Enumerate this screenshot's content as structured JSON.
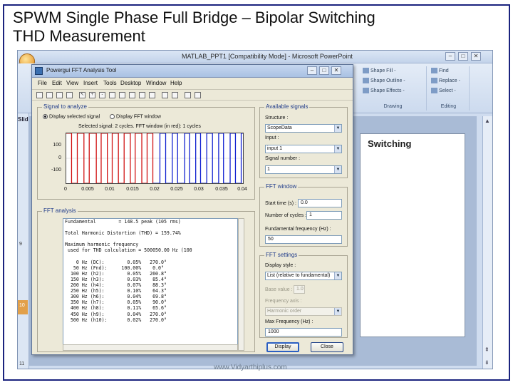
{
  "slide": {
    "title_line1": "SPWM Single Phase Full Bridge – Bipolar Switching",
    "title_line2": "THD Measurement",
    "watermark": "www.Vidyarthiplus.com"
  },
  "powerpoint": {
    "window_title": "MATLAB_PPT1 [Compatibility Mode] - Microsoft PowerPoint",
    "ribbon": {
      "shape_fill": "Shape Fill -",
      "shape_outline": "Shape Outline -",
      "shape_effects": "Shape Effects -",
      "find": "Find",
      "replace": "Replace -",
      "select": "Select -",
      "drawing_group": "Drawing",
      "editing_group": "Editing"
    },
    "slides_tab": "Slid",
    "thumb_numbers": [
      "9",
      "10",
      "11"
    ],
    "preview_text": "Switching"
  },
  "fft_tool": {
    "window_title": "Powergui FFT Analysis Tool",
    "menu": [
      "File",
      "Edit",
      "View",
      "Insert",
      "Tools",
      "Desktop",
      "Window",
      "Help"
    ],
    "signal_group": {
      "title": "Signal to analyze",
      "radio_selected_signal": "Display selected signal",
      "radio_fft_window": "Display FFT window",
      "plot_title": "Selected signal: 2 cycles. FFT window (in red): 1 cycles",
      "y_ticks": [
        "100",
        "0",
        "-100"
      ],
      "x_ticks": [
        "0",
        "0.005",
        "0.01",
        "0.015",
        "0.02",
        "0.025",
        "0.03",
        "0.035",
        "0.04"
      ]
    },
    "available_signals": {
      "title": "Available signals",
      "structure_label": "Structure :",
      "structure_value": "ScopeData",
      "input_label": "Input :",
      "input_value": "input 1",
      "signal_number_label": "Signal number :",
      "signal_number_value": "1"
    },
    "fft_window": {
      "title": "FFT window",
      "start_time_label": "Start time (s) :",
      "start_time_value": "0.0",
      "cycles_label": "Number of cycles :",
      "cycles_value": "1",
      "fundamental_label": "Fundamental frequency (Hz) :",
      "fundamental_value": "50"
    },
    "fft_settings": {
      "title": "FFT settings",
      "display_style_label": "Display style :",
      "display_style_value": "List (relative to fundamental)",
      "base_value_label": "Base value :",
      "base_value_value": "1.0",
      "freq_axis_label": "Frequency axis :",
      "freq_axis_value": "Harmonic order",
      "max_freq_label": "Max Frequency (Hz) :",
      "max_freq_value": "1000"
    },
    "fft_analysis": {
      "title": "FFT analysis",
      "report_lines": [
        "Fundamental        = 148.5 peak (105 rms)",
        "",
        "Total Harmonic Distortion (THD) = 159.74%",
        "",
        "Maximum harmonic frequency",
        " used for THD calculation = 500050.00 Hz (100",
        "",
        "    0 Hz (DC):        0.05%   270.0°",
        "   50 Hz (Fnd):     100.00%    0.0°",
        "  100 Hz (h2):        0.05%   260.8°",
        "  150 Hz (h3):        0.03%    85.4°",
        "  200 Hz (h4):        0.07%    88.3°",
        "  250 Hz (h5):        0.10%    64.3°",
        "  300 Hz (h6):        0.04%    69.8°",
        "  350 Hz (h7):        0.05%    90.0°",
        "  400 Hz (h8):        0.11%    65.6°",
        "  450 Hz (h9):        0.04%   270.0°",
        "  500 Hz (h10):       0.02%   270.0°"
      ]
    },
    "buttons": {
      "display": "Display",
      "close": "Close"
    }
  },
  "chart_data": {
    "type": "line",
    "title": "Selected signal: 2 cycles. FFT window (in red): 1 cycles",
    "xlabel": "",
    "ylabel": "",
    "xlim": [
      0,
      0.04
    ],
    "ylim": [
      -100,
      100
    ],
    "series": [
      {
        "name": "FFT window (in red)",
        "color": "#d01010",
        "x_range": [
          0,
          0.02
        ]
      },
      {
        "name": "Selected signal",
        "color": "#1020d0",
        "x_range": [
          0.02,
          0.04
        ]
      }
    ],
    "pulse_edges_s": [
      0.0012,
      0.0025,
      0.004,
      0.0052,
      0.0068,
      0.0079,
      0.0093,
      0.0104,
      0.0118,
      0.0131,
      0.0145,
      0.0156,
      0.0171,
      0.0183,
      0.0196,
      0.0212,
      0.0225,
      0.024,
      0.0252,
      0.0268,
      0.0279,
      0.0293,
      0.0304,
      0.0318,
      0.0331,
      0.0345,
      0.0356,
      0.0371,
      0.0383,
      0.0396
    ],
    "amplitude": 100
  }
}
